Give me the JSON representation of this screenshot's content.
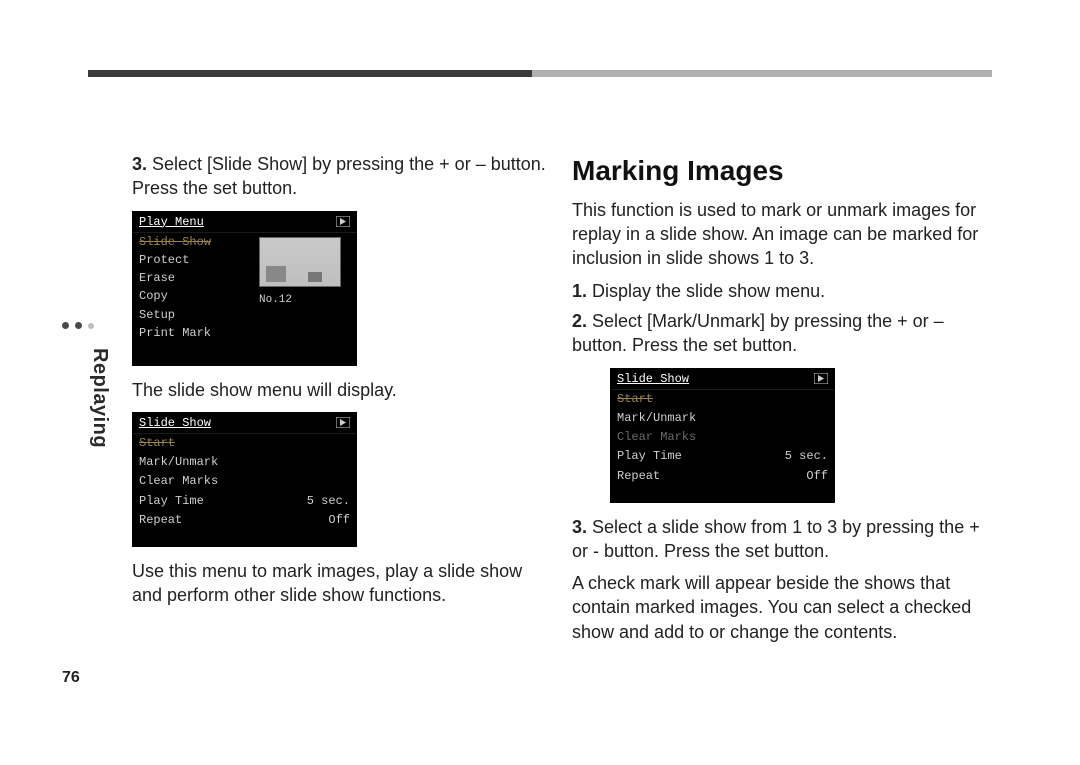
{
  "pageMeta": {
    "sectionLabel": "Replaying",
    "pageNumber": "76"
  },
  "left": {
    "step3_num": "3.",
    "step3_text": " Select [Slide Show] by pressing the + or – button. Press the set button.",
    "lcd1": {
      "title": "Play Menu",
      "items": [
        "Slide Show",
        "Protect",
        "Erase",
        "Copy",
        "Setup",
        "Print Mark"
      ],
      "selectedIndex": 0,
      "imageNo": "No.12"
    },
    "afterLcd1": "The slide show menu will display.",
    "lcd2": {
      "title": "Slide Show",
      "items": [
        "Start",
        "Mark/Unmark",
        "Clear Marks"
      ],
      "selectedIndex": 0,
      "pairs": [
        {
          "k": "Play Time",
          "v": "5 sec."
        },
        {
          "k": "Repeat",
          "v": "Off"
        }
      ]
    },
    "bottomPara": "Use this menu to mark images, play a slide show and perform other slide show functions."
  },
  "right": {
    "heading": "Marking Images",
    "intro": "This function is used to mark or unmark images for replay in a slide show. An image can be marked for inclusion in slide shows 1 to 3.",
    "step1_num": "1.",
    "step1_text": " Display the slide show menu.",
    "step2_num": "2.",
    "step2_text": " Select [Mark/Unmark] by pressing the + or – button. Press the set button.",
    "lcd3": {
      "title": "Slide Show",
      "items": [
        "Start",
        "Mark/Unmark",
        "Clear Marks"
      ],
      "selectedIndex": 0,
      "dimIndex": 2,
      "pairs": [
        {
          "k": "Play Time",
          "v": "5 sec."
        },
        {
          "k": "Repeat",
          "v": "Off"
        }
      ]
    },
    "step3_num": "3.",
    "step3_text": " Select a slide show from 1 to 3 by pressing the + or - button. Press the set button.",
    "step3_after": "A check mark will appear beside the shows that contain marked images. You can select a checked show and add to or change the contents."
  }
}
